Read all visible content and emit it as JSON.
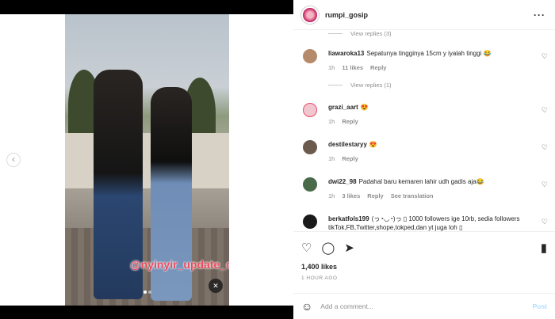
{
  "post": {
    "username": "rumpi_gosip",
    "watermark": "@nyinyir_update_official",
    "likes": "1,400 likes",
    "time": "1 HOUR AGO"
  },
  "comments": [
    {
      "username": "liawaroka13",
      "text": "Sepatunya tingginya 15cm y iyalah tinggi 😂",
      "time": "1h",
      "likes": "11 likes",
      "reply": "Reply",
      "avatar_color": "#b58a6a"
    },
    {
      "username": "grazi_aart",
      "text": "😍",
      "time": "1h",
      "reply": "Reply",
      "avatar_color": "#e94b6a"
    },
    {
      "username": "destilestaryy",
      "text": "😍",
      "time": "1h",
      "reply": "Reply",
      "avatar_color": "#6b5a4e"
    },
    {
      "username": "dwi22_98",
      "text": "Padahal baru kemaren lahir udh gadis aja😂",
      "time": "1h",
      "likes": "3 likes",
      "reply": "Reply",
      "translation": "See translation",
      "avatar_color": "#4a6b4a"
    },
    {
      "username": "berkatfols199",
      "text": "(っ◔◡◔)っ ▯ 1000 followers ige 10rb, sedia followers tikTok,FB,Twitter,shope,tokped,dan yt juga loh ▯",
      "avatar_color": "#1a1a1a"
    }
  ],
  "view_replies": [
    "View replies (3)",
    "View replies (1)"
  ],
  "add_comment": {
    "placeholder": "Add a comment...",
    "post_label": "Post"
  },
  "icons": {
    "more": "more-icon",
    "like": "heart-icon",
    "comment": "comment-icon",
    "share": "share-icon",
    "save": "bookmark-icon",
    "emoji": "emoji-icon",
    "mute": "mute-icon",
    "prev": "chevron-left-icon"
  },
  "colors": {
    "accent": "#0095f6",
    "post_disabled": "#b2dffc",
    "watermark": "#e84b5b"
  }
}
